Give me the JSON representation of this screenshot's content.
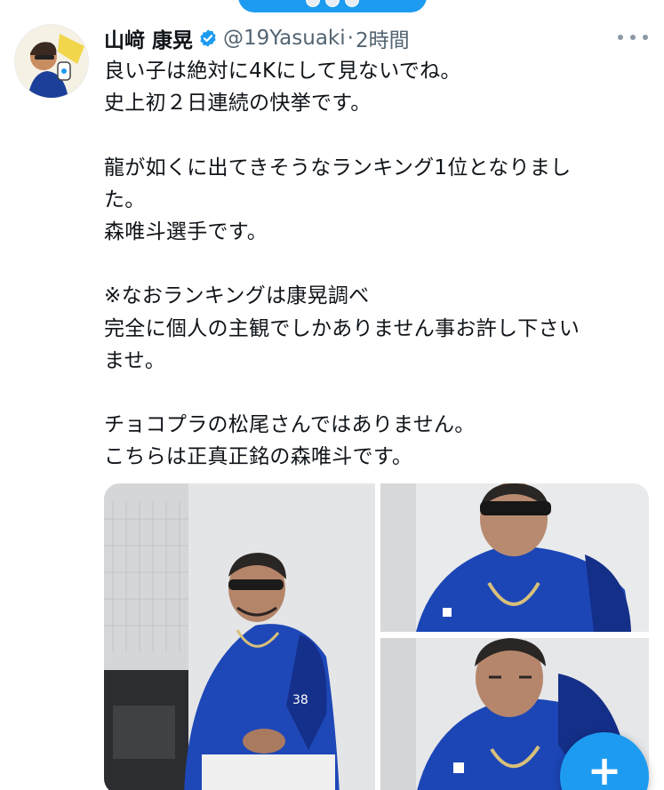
{
  "tweet": {
    "author_name": "山﨑 康晃",
    "handle": "@19Yasuaki",
    "separator": "·",
    "time": "2時間",
    "lines": [
      "良い子は絶対に4Kにして見ないでね。",
      "史上初２日連続の快挙です。",
      "",
      "龍が如くに出てきそうなランキング1位となりまし",
      "た。",
      "森唯斗選手です。",
      "",
      "※なおランキングは康晃調べ",
      "完全に個人の主観でしかありません事お許し下さい",
      "ませ。",
      "",
      "チョコプラの松尾さんではありません。",
      "こちらは正真正銘の森唯斗です。"
    ]
  },
  "media": {
    "photo_count": 3,
    "left_jersey_number": "38"
  },
  "fab": {
    "label": "+"
  },
  "colors": {
    "accent": "#1d9bf0",
    "text": "#0f1419",
    "secondary": "#536471"
  },
  "icons": {
    "verified": "verified-badge-icon",
    "more": "more-options-icon",
    "compose": "compose-plus-icon"
  }
}
